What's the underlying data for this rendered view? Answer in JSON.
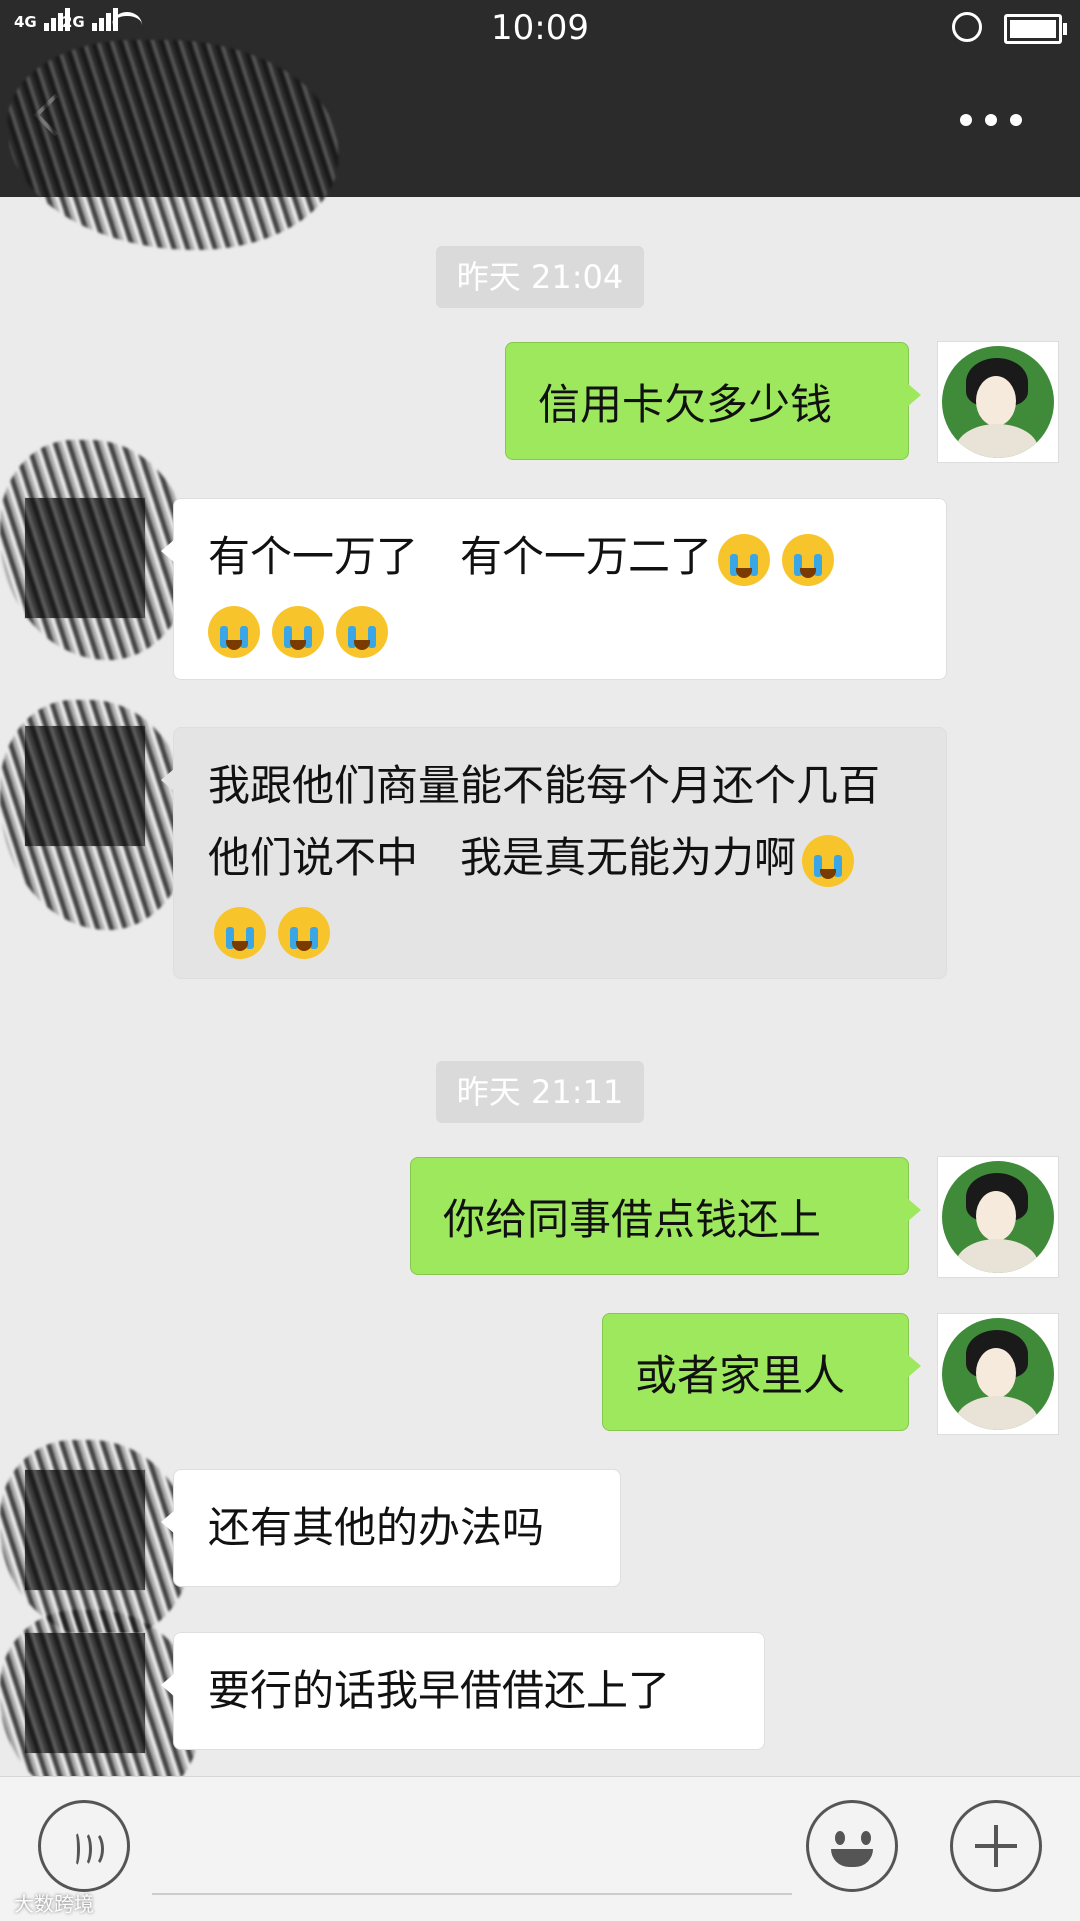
{
  "status_bar": {
    "network_1": "4G",
    "network_2": "2G",
    "time": "10:09"
  },
  "nav": {
    "back_icon": "chevron-left-icon",
    "more_icon": "more-dots-icon"
  },
  "messages": [
    {
      "type": "timestamp",
      "text": "昨天 21:04"
    },
    {
      "type": "sent",
      "text": "信用卡欠多少钱"
    },
    {
      "type": "received",
      "text": "有个一万了　有个一万二了",
      "emoji_count": 5,
      "emoji": "crying-face"
    },
    {
      "type": "received",
      "text": "我跟他们商量能不能每个月还个几百　他们说不中　我是真无能为力啊",
      "emoji_count": 3,
      "emoji": "crying-face"
    },
    {
      "type": "timestamp",
      "text": "昨天 21:11"
    },
    {
      "type": "sent",
      "text": "你给同事借点钱还上"
    },
    {
      "type": "sent",
      "text": "或者家里人"
    },
    {
      "type": "received",
      "text": "还有其他的办法吗"
    },
    {
      "type": "received",
      "text": "要行的话我早借借还上了"
    }
  ],
  "input_bar": {
    "voice_icon": "voice-icon",
    "emoji_icon": "smiley-icon",
    "plus_icon": "plus-icon"
  },
  "watermark": "大数跨境",
  "colors": {
    "sent_bubble": "#9ee85e",
    "received_bubble": "#ffffff",
    "nav_bg": "#2b2b2b",
    "chat_bg": "#ebebeb"
  }
}
